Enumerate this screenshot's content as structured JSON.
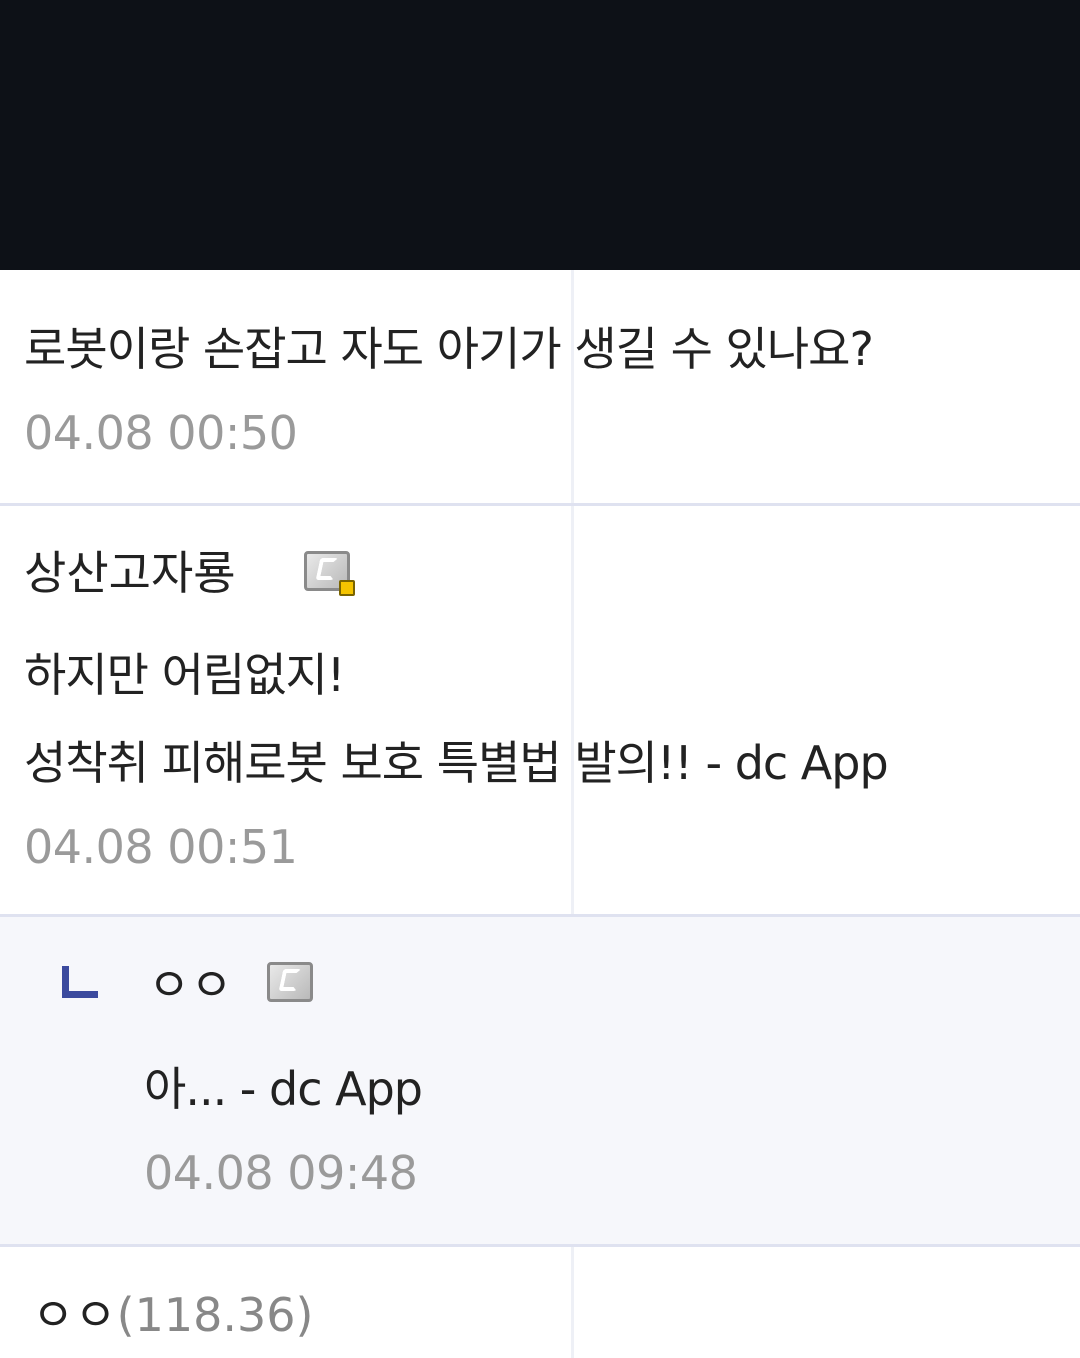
{
  "comments": [
    {
      "body": "로봇이랑 손잡고 자도 아기가 생길 수 있나요?",
      "date": "04.08 00:50"
    },
    {
      "nickname": "상산고자룡",
      "line1": "하지만 어림없지!",
      "line2": "성착취 피해로봇 보호 특별법 발의!! - dc App",
      "date": "04.08 00:51"
    }
  ],
  "reply": {
    "nickname": "ㅇㅇ",
    "body": "아... - dc App",
    "date": "04.08 09:48"
  },
  "last": {
    "nickname": "ㅇㅇ",
    "ip": "(118.36)"
  },
  "colors": {
    "top_bar": "#0d1117",
    "reply_background": "#f6f7fb",
    "reply_mark": "#3b4a9e",
    "date_text": "#9a9a9a"
  },
  "icons": [
    "gallog-icon",
    "reply-arrow-icon"
  ]
}
